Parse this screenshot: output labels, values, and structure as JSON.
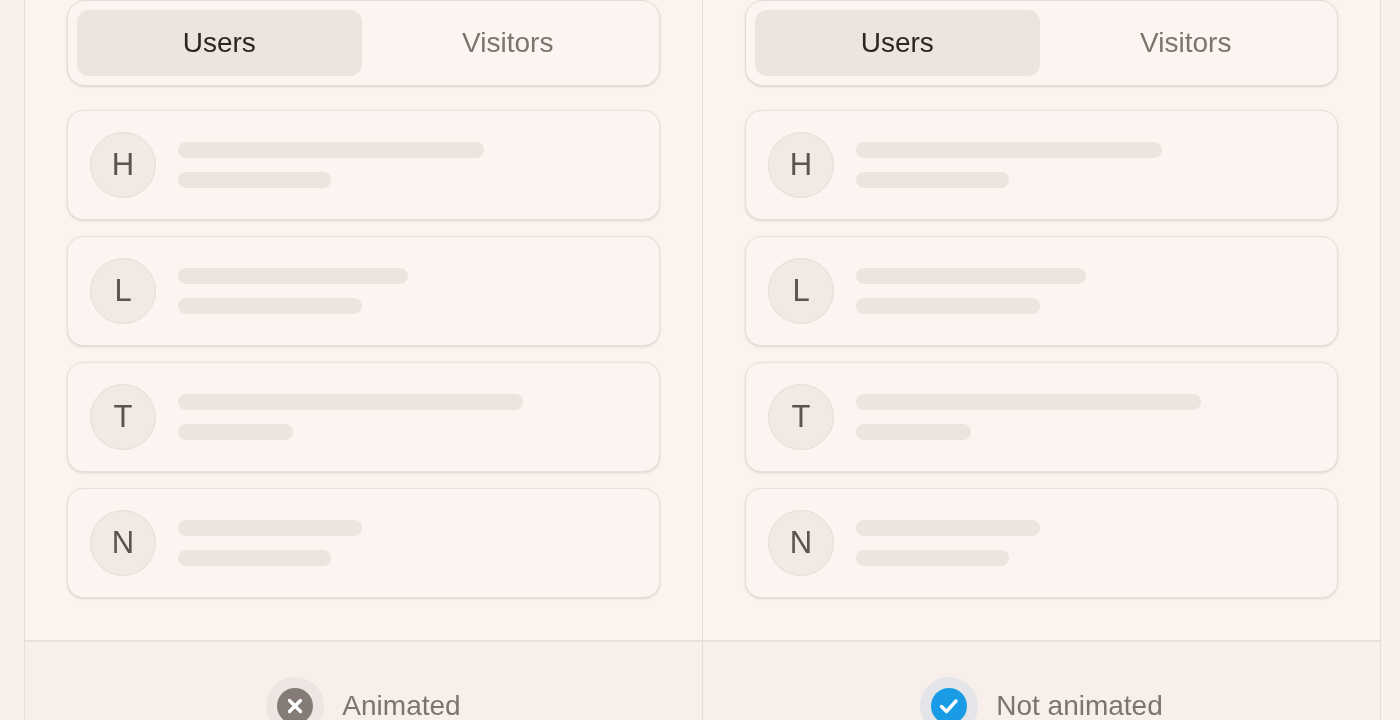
{
  "panels": [
    {
      "tabs": [
        {
          "label": "Users",
          "selected": true
        },
        {
          "label": "Visitors",
          "selected": false
        }
      ],
      "rows": [
        {
          "initial": "H"
        },
        {
          "initial": "L"
        },
        {
          "initial": "T"
        },
        {
          "initial": "N"
        }
      ],
      "footer": {
        "label": "Animated",
        "checked": false
      }
    },
    {
      "tabs": [
        {
          "label": "Users",
          "selected": true
        },
        {
          "label": "Visitors",
          "selected": false
        }
      ],
      "rows": [
        {
          "initial": "H"
        },
        {
          "initial": "L"
        },
        {
          "initial": "T"
        },
        {
          "initial": "N"
        }
      ],
      "footer": {
        "label": "Not animated",
        "checked": true
      }
    }
  ]
}
